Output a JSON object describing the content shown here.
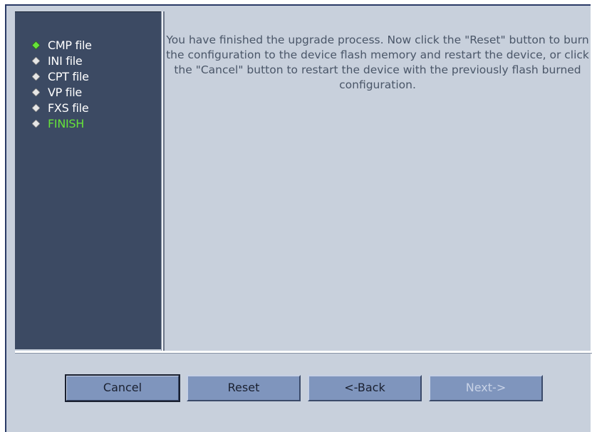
{
  "sidebar": {
    "steps": [
      {
        "label": "CMP file",
        "state": "done"
      },
      {
        "label": "INI file",
        "state": "pending"
      },
      {
        "label": "CPT file",
        "state": "pending"
      },
      {
        "label": "VP file",
        "state": "pending"
      },
      {
        "label": "FXS file",
        "state": "pending"
      },
      {
        "label": "FINISH",
        "state": "current"
      }
    ]
  },
  "main": {
    "message": "You have finished the upgrade process. Now click the \"Reset\" button to burn the configuration to the device flash memory and restart the device, or click the \"Cancel\" button to restart the device with the previously flash burned configuration."
  },
  "buttons": {
    "cancel": "Cancel",
    "reset": "Reset",
    "back": "<-Back",
    "next": "Next->"
  },
  "colors": {
    "sidebar_bg": "#3c4a63",
    "content_bg": "#c8d0dc",
    "active_step": "#66e23a",
    "button_bg": "#7f95bd"
  }
}
